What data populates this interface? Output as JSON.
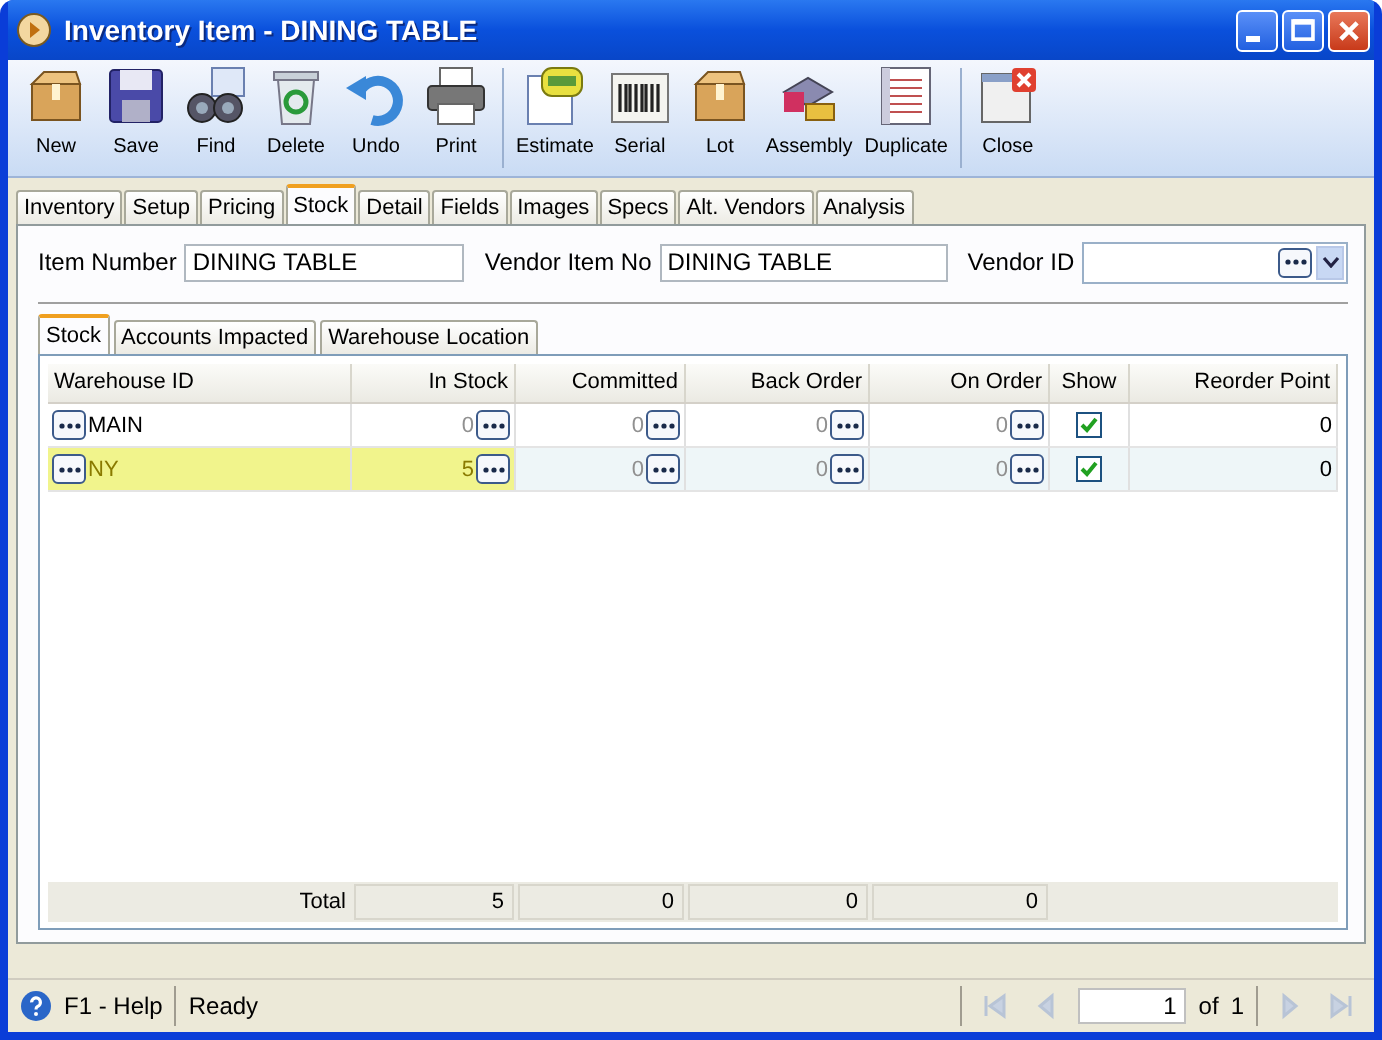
{
  "window": {
    "title": "Inventory Item - DINING TABLE"
  },
  "toolbar": [
    {
      "buttons": [
        {
          "label": "New"
        },
        {
          "label": "Save"
        },
        {
          "label": "Find"
        },
        {
          "label": "Delete"
        },
        {
          "label": "Undo"
        },
        {
          "label": "Print"
        }
      ]
    },
    {
      "buttons": [
        {
          "label": "Estimate"
        },
        {
          "label": "Serial"
        },
        {
          "label": "Lot"
        },
        {
          "label": "Assembly"
        },
        {
          "label": "Duplicate"
        }
      ]
    },
    {
      "buttons": [
        {
          "label": "Close"
        }
      ]
    }
  ],
  "tabs": [
    {
      "label": "Inventory",
      "selected": false
    },
    {
      "label": "Setup",
      "selected": false
    },
    {
      "label": "Pricing",
      "selected": false
    },
    {
      "label": "Stock",
      "selected": true
    },
    {
      "label": "Detail",
      "selected": false
    },
    {
      "label": "Fields",
      "selected": false
    },
    {
      "label": "Images",
      "selected": false
    },
    {
      "label": "Specs",
      "selected": false
    },
    {
      "label": "Alt. Vendors",
      "selected": false
    },
    {
      "label": "Analysis",
      "selected": false
    }
  ],
  "fields": [
    {
      "label": "Item Number",
      "value": "DINING TABLE",
      "kind": "text"
    },
    {
      "label": "Vendor Item No",
      "value": "DINING TABLE",
      "kind": "text"
    },
    {
      "label": "Vendor ID",
      "kind": "combo"
    }
  ],
  "sub_tabs": [
    {
      "label": "Stock",
      "selected": true
    },
    {
      "label": "Accounts Impacted",
      "selected": false
    },
    {
      "label": "Warehouse Location",
      "selected": false
    }
  ],
  "grid": {
    "columns": [
      "Warehouse ID",
      "In Stock",
      "Committed",
      "Back Order",
      "On Order",
      "Show",
      "Reorder Point"
    ],
    "rows": [
      {
        "cells": [
          "MAIN",
          "0",
          "0",
          "0",
          "0"
        ],
        "show": true,
        "reorder_point": "0",
        "selected": false
      },
      {
        "cells": [
          "NY",
          "5",
          "0",
          "0",
          "0"
        ],
        "show": true,
        "reorder_point": "0",
        "selected": true
      }
    ],
    "totals": {
      "label": "Total",
      "values": [
        "5",
        "0",
        "0",
        "0"
      ]
    }
  },
  "status_bar": {
    "help": "F1 - Help",
    "status": "Ready",
    "page": "1",
    "of": "of",
    "pages": "1",
    "nav": [
      {
        "kind": "first",
        "disabled": true
      },
      {
        "kind": "prev",
        "disabled": true
      },
      {
        "kind": "next",
        "disabled": true
      },
      {
        "kind": "last",
        "disabled": true
      }
    ]
  }
}
